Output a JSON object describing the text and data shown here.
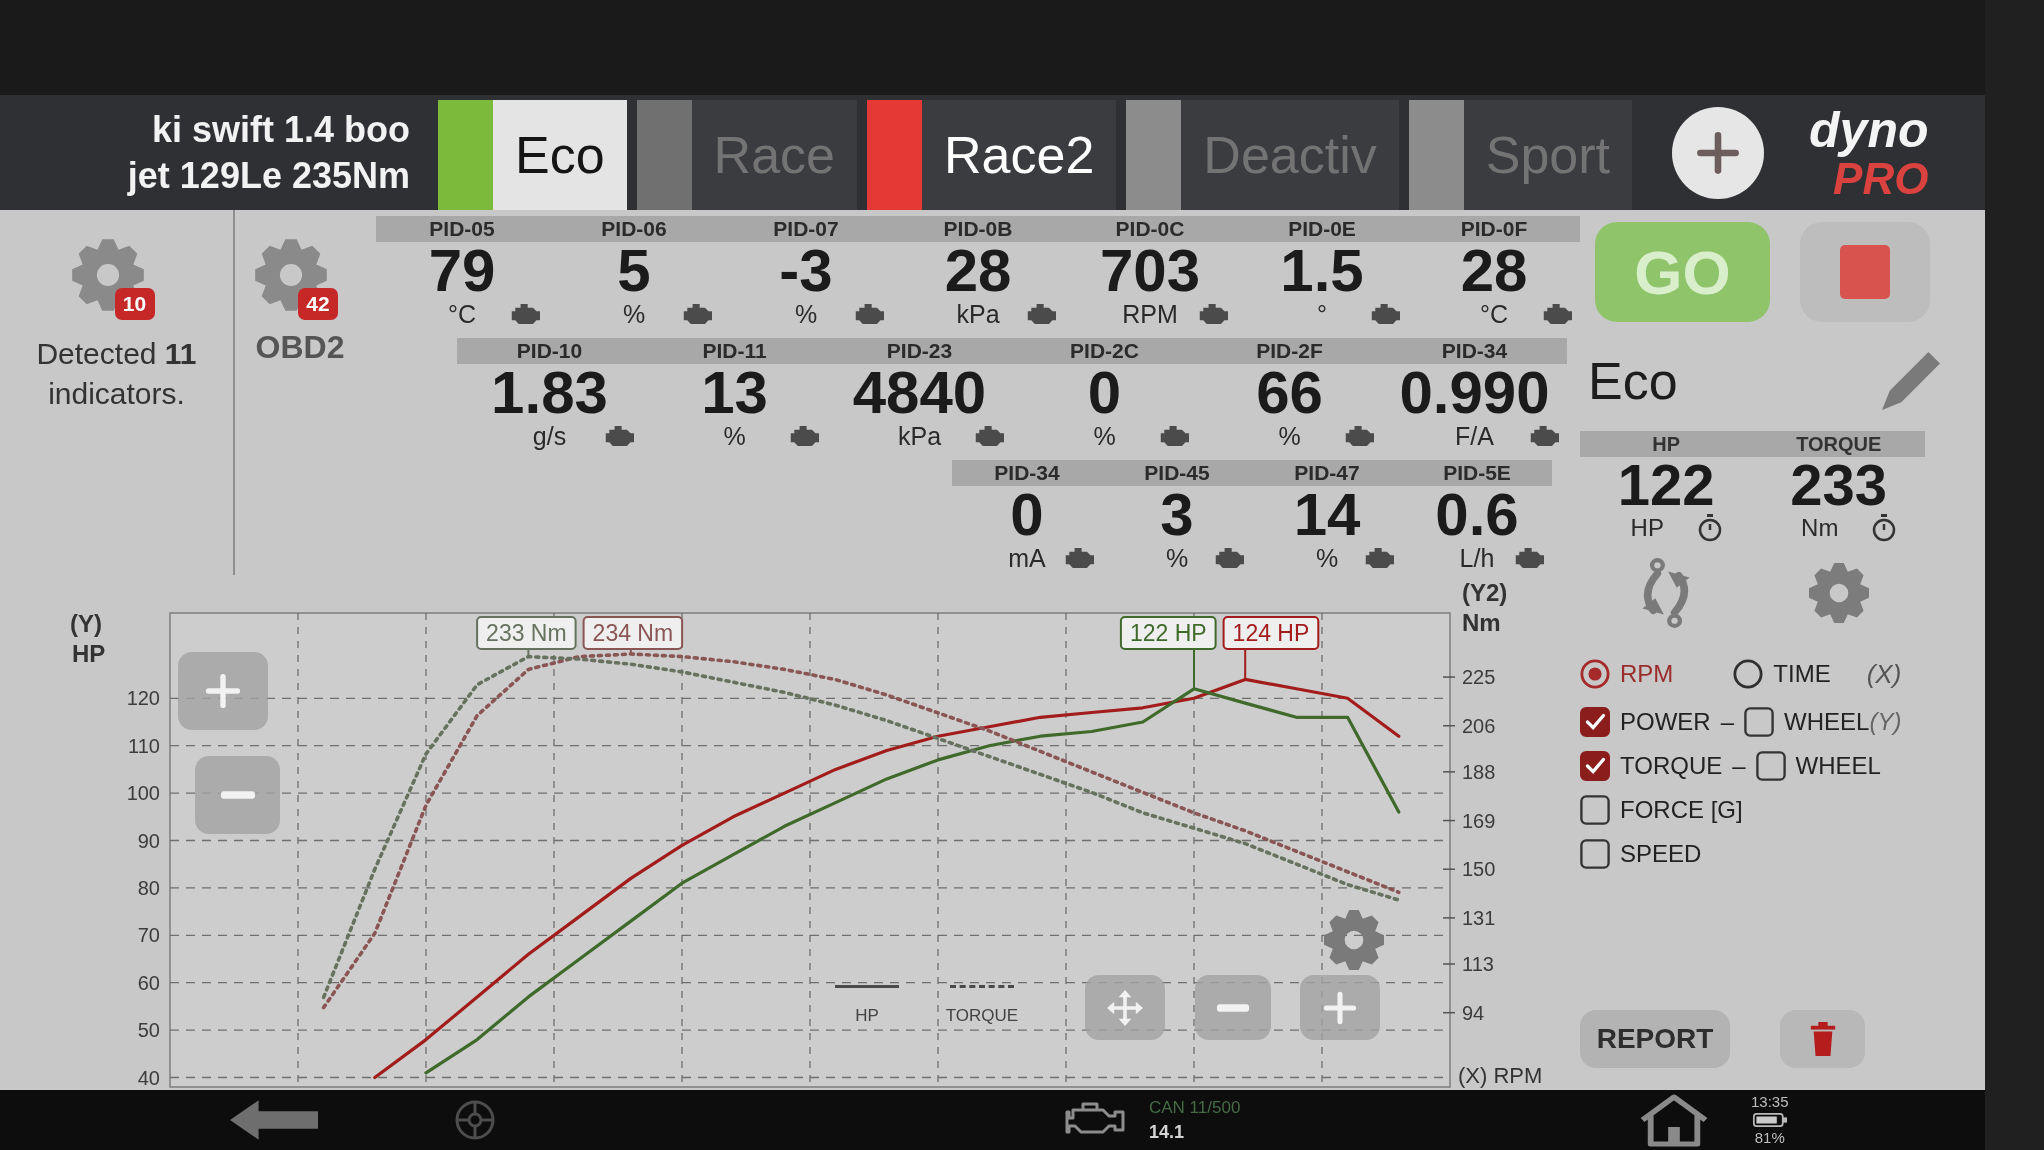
{
  "header": {
    "vehicle_lines": [
      "ki swift 1.4 boo",
      "jet 129Le 235Nm"
    ],
    "tabs": [
      {
        "label": "Eco",
        "color": "#7cba3c",
        "selected": true,
        "disabled": false
      },
      {
        "label": "Race",
        "color": "#707070",
        "selected": false,
        "disabled": true
      },
      {
        "label": "Race2",
        "color": "#e53935",
        "selected": false,
        "disabled": false
      },
      {
        "label": "Deactiv",
        "color": "#8c8c8c",
        "selected": false,
        "disabled": true
      },
      {
        "label": "Sport",
        "color": "#8c8c8c",
        "selected": false,
        "disabled": true
      }
    ],
    "logo": {
      "line_1": "dyno",
      "line_2": "PRO"
    }
  },
  "sidebar": {
    "badge": "10",
    "text": "Detected **11** indicators."
  },
  "obd": {
    "badge": "42",
    "label": "OBD2"
  },
  "pid_panel": {
    "strips": [
      {
        "gauges": [
          {
            "pid": "PID-05",
            "value": "79",
            "unit": "°C"
          },
          {
            "pid": "PID-06",
            "value": "5",
            "unit": "%"
          },
          {
            "pid": "PID-07",
            "value": "-3",
            "unit": "%"
          },
          {
            "pid": "PID-0B",
            "value": "28",
            "unit": "kPa"
          },
          {
            "pid": "PID-0C",
            "value": "703",
            "unit": "RPM"
          },
          {
            "pid": "PID-0E",
            "value": "1.5",
            "unit": "°"
          },
          {
            "pid": "PID-0F",
            "value": "28",
            "unit": "°C"
          }
        ]
      },
      {
        "gauges": [
          {
            "pid": "PID-10",
            "value": "1.83",
            "unit": "g/s"
          },
          {
            "pid": "PID-11",
            "value": "13",
            "unit": "%"
          },
          {
            "pid": "PID-23",
            "value": "4840",
            "unit": "kPa"
          },
          {
            "pid": "PID-2C",
            "value": "0",
            "unit": "%"
          },
          {
            "pid": "PID-2F",
            "value": "66",
            "unit": "%"
          },
          {
            "pid": "PID-34",
            "value": "0.990",
            "unit": "F/A"
          }
        ]
      },
      {
        "gauges": [
          {
            "pid": "PID-34",
            "value": "0",
            "unit": "mA"
          },
          {
            "pid": "PID-45",
            "value": "3",
            "unit": "%"
          },
          {
            "pid": "PID-47",
            "value": "14",
            "unit": "%"
          },
          {
            "pid": "PID-5E",
            "value": "0.6",
            "unit": "L/h"
          }
        ]
      }
    ]
  },
  "run_panel": {
    "go_label": "GO",
    "profile": "Eco",
    "readouts": [
      {
        "title": "HP",
        "value": "122",
        "unit": "HP"
      },
      {
        "title": "TORQUE",
        "value": "233",
        "unit": "Nm"
      }
    ],
    "x_axis": {
      "options": [
        {
          "label": "RPM",
          "selected": true
        },
        {
          "label": "TIME",
          "selected": false
        }
      ],
      "tag": "(X)"
    },
    "series_options": [
      {
        "label": "POWER",
        "checked": true,
        "dash": "–",
        "wheel": {
          "label": "WHEEL",
          "checked": false
        },
        "tag": "(Y)"
      },
      {
        "label": "TORQUE",
        "checked": true,
        "dash": "–",
        "wheel": {
          "label": "WHEEL",
          "checked": false
        }
      },
      {
        "label": "FORCE [G]",
        "checked": false
      },
      {
        "label": "SPEED",
        "checked": false
      }
    ],
    "report_label": "REPORT"
  },
  "chart": {
    "axis_tags": {
      "y": "(Y)",
      "y2": "(Y2)",
      "x": "(X)"
    },
    "legend": [
      {
        "label": "HP",
        "dashed": false
      },
      {
        "label": "TORQUE",
        "dashed": true
      }
    ],
    "chart_data": {
      "type": "line",
      "grid": true,
      "xlabel": "RPM",
      "ylabel": "HP",
      "y2label": "Nm",
      "ylim": [
        38,
        138
      ],
      "y2lim": [
        65,
        250
      ],
      "yticks": [
        40,
        50,
        60,
        70,
        80,
        90,
        100,
        110,
        120
      ],
      "y2ticks": [
        94,
        113,
        131,
        150,
        169,
        188,
        206,
        225
      ],
      "series": [
        {
          "color": "#a31c1c",
          "line_style": "solid",
          "axis": "y",
          "values": [
            null,
            null,
            40,
            48,
            57,
            66,
            74,
            82,
            89,
            95,
            100,
            105,
            109,
            112,
            114,
            116,
            117,
            118,
            120,
            124,
            122,
            120,
            112
          ]
        },
        {
          "color": "#3f6a2b",
          "line_style": "solid",
          "axis": "y",
          "values": [
            null,
            null,
            null,
            41,
            48,
            57,
            65,
            73,
            81,
            87,
            93,
            98,
            103,
            107,
            110,
            112,
            113,
            115,
            122,
            119,
            116,
            116,
            96
          ]
        },
        {
          "color": "#8a5555",
          "line_style": "dashed",
          "axis": "y2",
          "values": [
            null,
            96,
            125,
            175,
            210,
            228,
            233,
            234,
            233,
            231,
            228,
            224,
            218,
            211,
            204,
            196,
            188,
            180,
            172,
            165,
            157,
            149,
            141
          ]
        },
        {
          "color": "#66725f",
          "line_style": "dashed",
          "axis": "y2",
          "values": [
            null,
            100,
            150,
            195,
            222,
            233,
            232,
            230,
            227,
            223,
            219,
            214,
            208,
            201,
            194,
            187,
            180,
            172,
            166,
            160,
            152,
            144,
            138
          ]
        }
      ],
      "annotations": [
        "233 Nm",
        "234 Nm",
        "122 HP",
        "124 HP"
      ]
    }
  },
  "status_bar": {
    "can": "CAN 11/500",
    "voltage": "14.1",
    "time": "13:35",
    "battery": "81%"
  }
}
